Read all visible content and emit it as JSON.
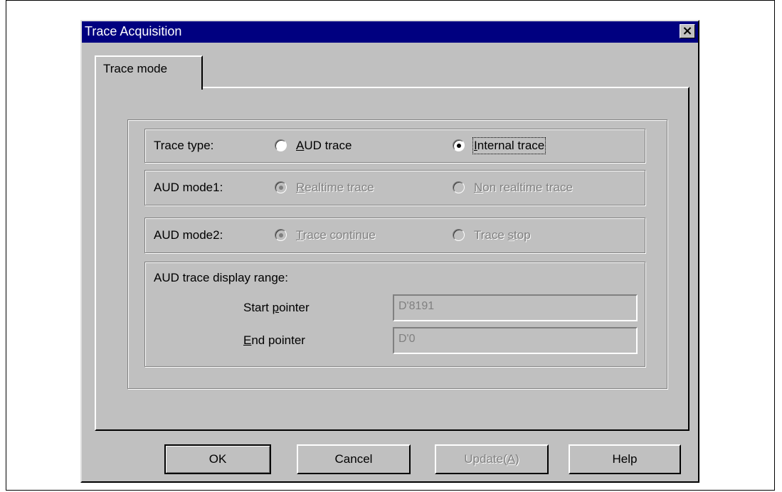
{
  "window": {
    "title": "Trace Acquisition",
    "close_label": "×"
  },
  "tabs": [
    {
      "label": "Trace mode"
    }
  ],
  "trace_type": {
    "label": "Trace type:",
    "options": [
      {
        "label_mnemonic": "A",
        "label_rest": "UD trace",
        "selected": false,
        "enabled": true
      },
      {
        "label_mnemonic": "I",
        "label_rest": "nternal trace",
        "selected": true,
        "enabled": true
      }
    ]
  },
  "aud_mode1": {
    "label": "AUD mode1:",
    "options": [
      {
        "label_mnemonic": "R",
        "label_rest": "ealtime trace",
        "selected": true,
        "enabled": false
      },
      {
        "label_mnemonic": "N",
        "label_rest": "on realtime trace",
        "selected": false,
        "enabled": false
      }
    ]
  },
  "aud_mode2": {
    "label": "AUD mode2:",
    "options": [
      {
        "label_mnemonic": "T",
        "label_rest": "race continue",
        "selected": true,
        "enabled": false
      },
      {
        "label_pre": "Trace ",
        "label_mnemonic": "s",
        "label_rest": "top",
        "selected": false,
        "enabled": false
      }
    ]
  },
  "display_range": {
    "label": "AUD trace display range:",
    "start_pre": "Start ",
    "start_mnemonic": "p",
    "start_rest": "ointer",
    "start_value": "D'8191",
    "end_mnemonic": "E",
    "end_rest": "nd pointer",
    "end_value": "D'0"
  },
  "buttons": {
    "ok": "OK",
    "cancel": "Cancel",
    "update_pre": "Update(",
    "update_mnemonic": "A",
    "update_post": ")",
    "help": "Help"
  }
}
